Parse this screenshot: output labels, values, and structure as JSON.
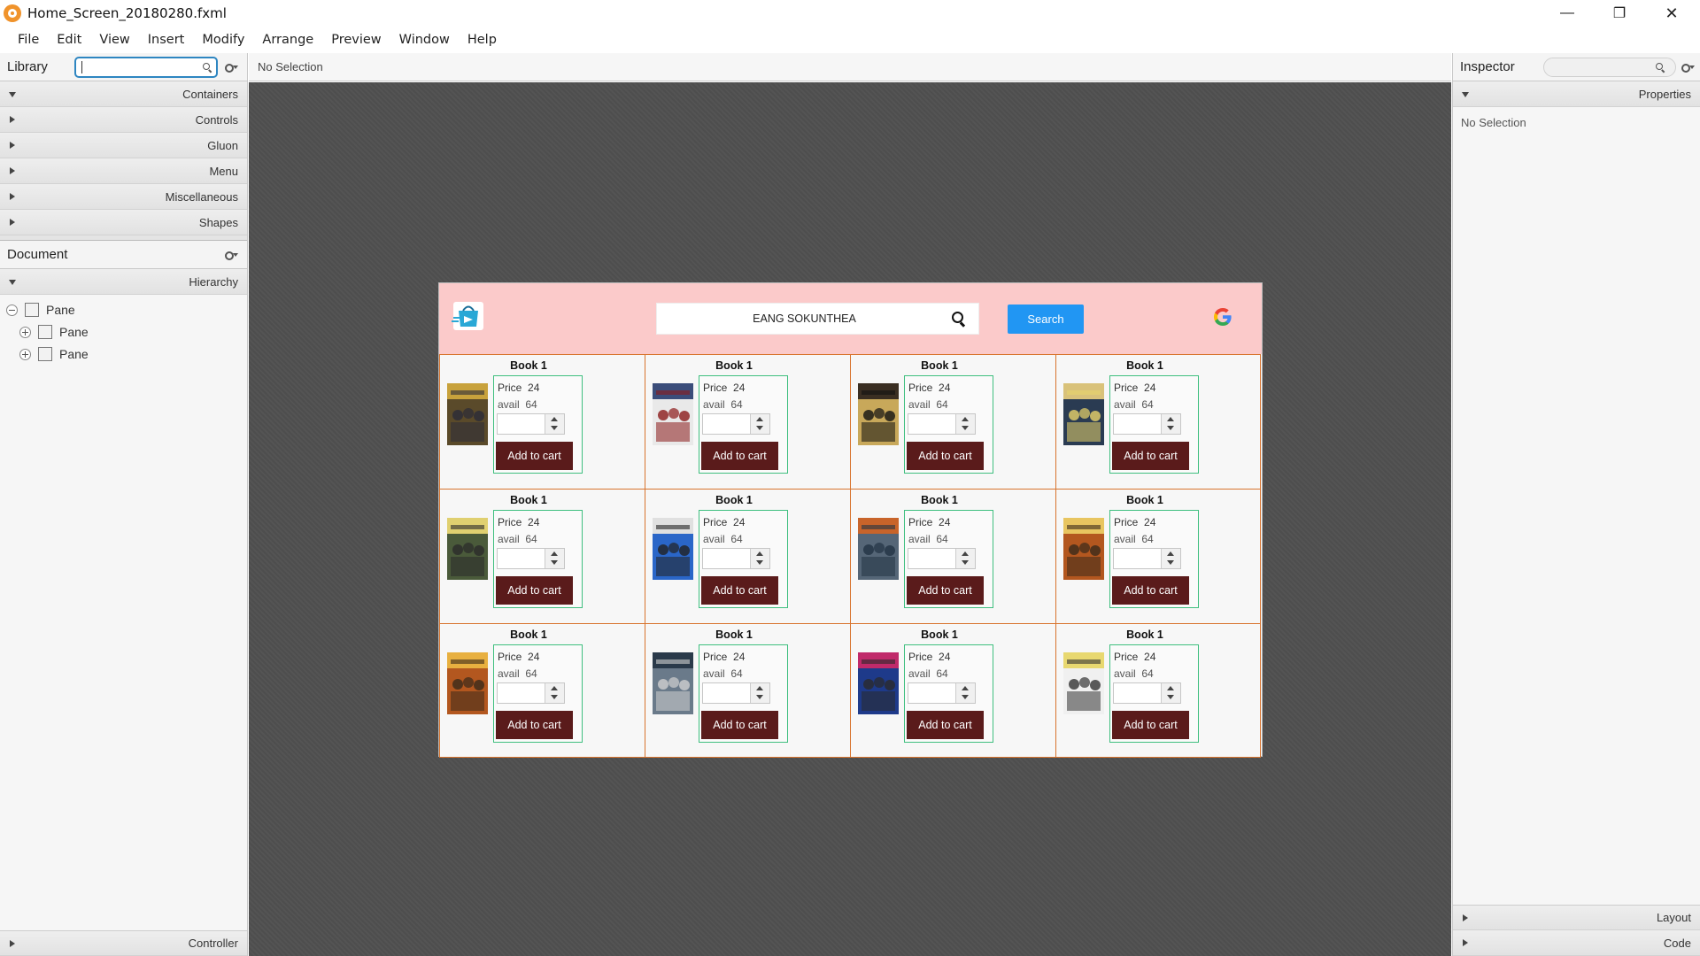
{
  "window": {
    "title": "Home_Screen_20180280.fxml",
    "controls": {
      "minimize": "—",
      "maximize": "❐",
      "close": "✕"
    }
  },
  "menubar": [
    "File",
    "Edit",
    "View",
    "Insert",
    "Modify",
    "Arrange",
    "Preview",
    "Window",
    "Help"
  ],
  "library": {
    "title": "Library",
    "search_value": "",
    "sections": [
      "Containers",
      "Controls",
      "Gluon",
      "Menu",
      "Miscellaneous",
      "Shapes"
    ]
  },
  "document": {
    "title": "Document",
    "section": "Hierarchy",
    "tree": [
      {
        "label": "Pane",
        "level": 0,
        "toggle": "minus"
      },
      {
        "label": "Pane",
        "level": 1,
        "toggle": "plus"
      },
      {
        "label": "Pane",
        "level": 1,
        "toggle": "plus"
      }
    ],
    "footer": "Controller"
  },
  "center": {
    "selection_label": "No Selection"
  },
  "inspector": {
    "title": "Inspector",
    "section": "Properties",
    "no_selection": "No Selection",
    "footer_sections": [
      "Layout",
      "Code"
    ]
  },
  "app": {
    "search_value": "EANG SOKUNTHEA",
    "search_button": "Search",
    "header_color": "#fbcaca",
    "accent": "#2196f3",
    "cart_button_color": "#5a1b1b",
    "books": [
      {
        "title": "Book 1",
        "price_label": "Price",
        "price": "24",
        "avail_label": "avail",
        "avail": "64",
        "button": "Add to cart",
        "poster": [
          "#5a4a2a",
          "#c8a23c",
          "#2b2b38"
        ]
      },
      {
        "title": "Book 1",
        "price_label": "Price",
        "price": "24",
        "avail_label": "avail",
        "avail": "64",
        "button": "Add to cart",
        "poster": [
          "#e9e9e9",
          "#3b4d7a",
          "#8b1a1a"
        ]
      },
      {
        "title": "Book 1",
        "price_label": "Price",
        "price": "24",
        "avail_label": "avail",
        "avail": "64",
        "button": "Add to cart",
        "poster": [
          "#c8a85a",
          "#3a2e22",
          "#111111"
        ]
      },
      {
        "title": "Book 1",
        "price_label": "Price",
        "price": "24",
        "avail_label": "avail",
        "avail": "64",
        "button": "Add to cart",
        "poster": [
          "#2a3b52",
          "#d9c27a",
          "#e8d36a"
        ]
      },
      {
        "title": "Book 1",
        "price_label": "Price",
        "price": "24",
        "avail_label": "avail",
        "avail": "64",
        "button": "Add to cart",
        "poster": [
          "#4a5a3a",
          "#e0d070",
          "#2a2a2a"
        ]
      },
      {
        "title": "Book 1",
        "price_label": "Price",
        "price": "24",
        "avail_label": "avail",
        "avail": "64",
        "button": "Add to cart",
        "poster": [
          "#2a66c8",
          "#e0e0e0",
          "#222222"
        ]
      },
      {
        "title": "Book 1",
        "price_label": "Price",
        "price": "24",
        "avail_label": "avail",
        "avail": "64",
        "button": "Add to cart",
        "poster": [
          "#556677",
          "#c8642a",
          "#223344"
        ]
      },
      {
        "title": "Book 1",
        "price_label": "Price",
        "price": "24",
        "avail_label": "avail",
        "avail": "64",
        "button": "Add to cart",
        "poster": [
          "#b3571f",
          "#e8c560",
          "#3a2a1a"
        ]
      },
      {
        "title": "Book 1",
        "price_label": "Price",
        "price": "24",
        "avail_label": "avail",
        "avail": "64",
        "button": "Add to cart",
        "poster": [
          "#b3571f",
          "#e8b040",
          "#3a2a1a"
        ]
      },
      {
        "title": "Book 1",
        "price_label": "Price",
        "price": "24",
        "avail_label": "avail",
        "avail": "64",
        "button": "Add to cart",
        "poster": [
          "#6a7a8a",
          "#2a3a4a",
          "#d0d0d0"
        ]
      },
      {
        "title": "Book 1",
        "price_label": "Price",
        "price": "24",
        "avail_label": "avail",
        "avail": "64",
        "button": "Add to cart",
        "poster": [
          "#1e3a8a",
          "#c02a6a",
          "#2a2a2a"
        ]
      },
      {
        "title": "Book 1",
        "price_label": "Price",
        "price": "24",
        "avail_label": "avail",
        "avail": "64",
        "button": "Add to cart",
        "poster": [
          "#f0f0f0",
          "#e8d870",
          "#333333"
        ]
      }
    ]
  }
}
